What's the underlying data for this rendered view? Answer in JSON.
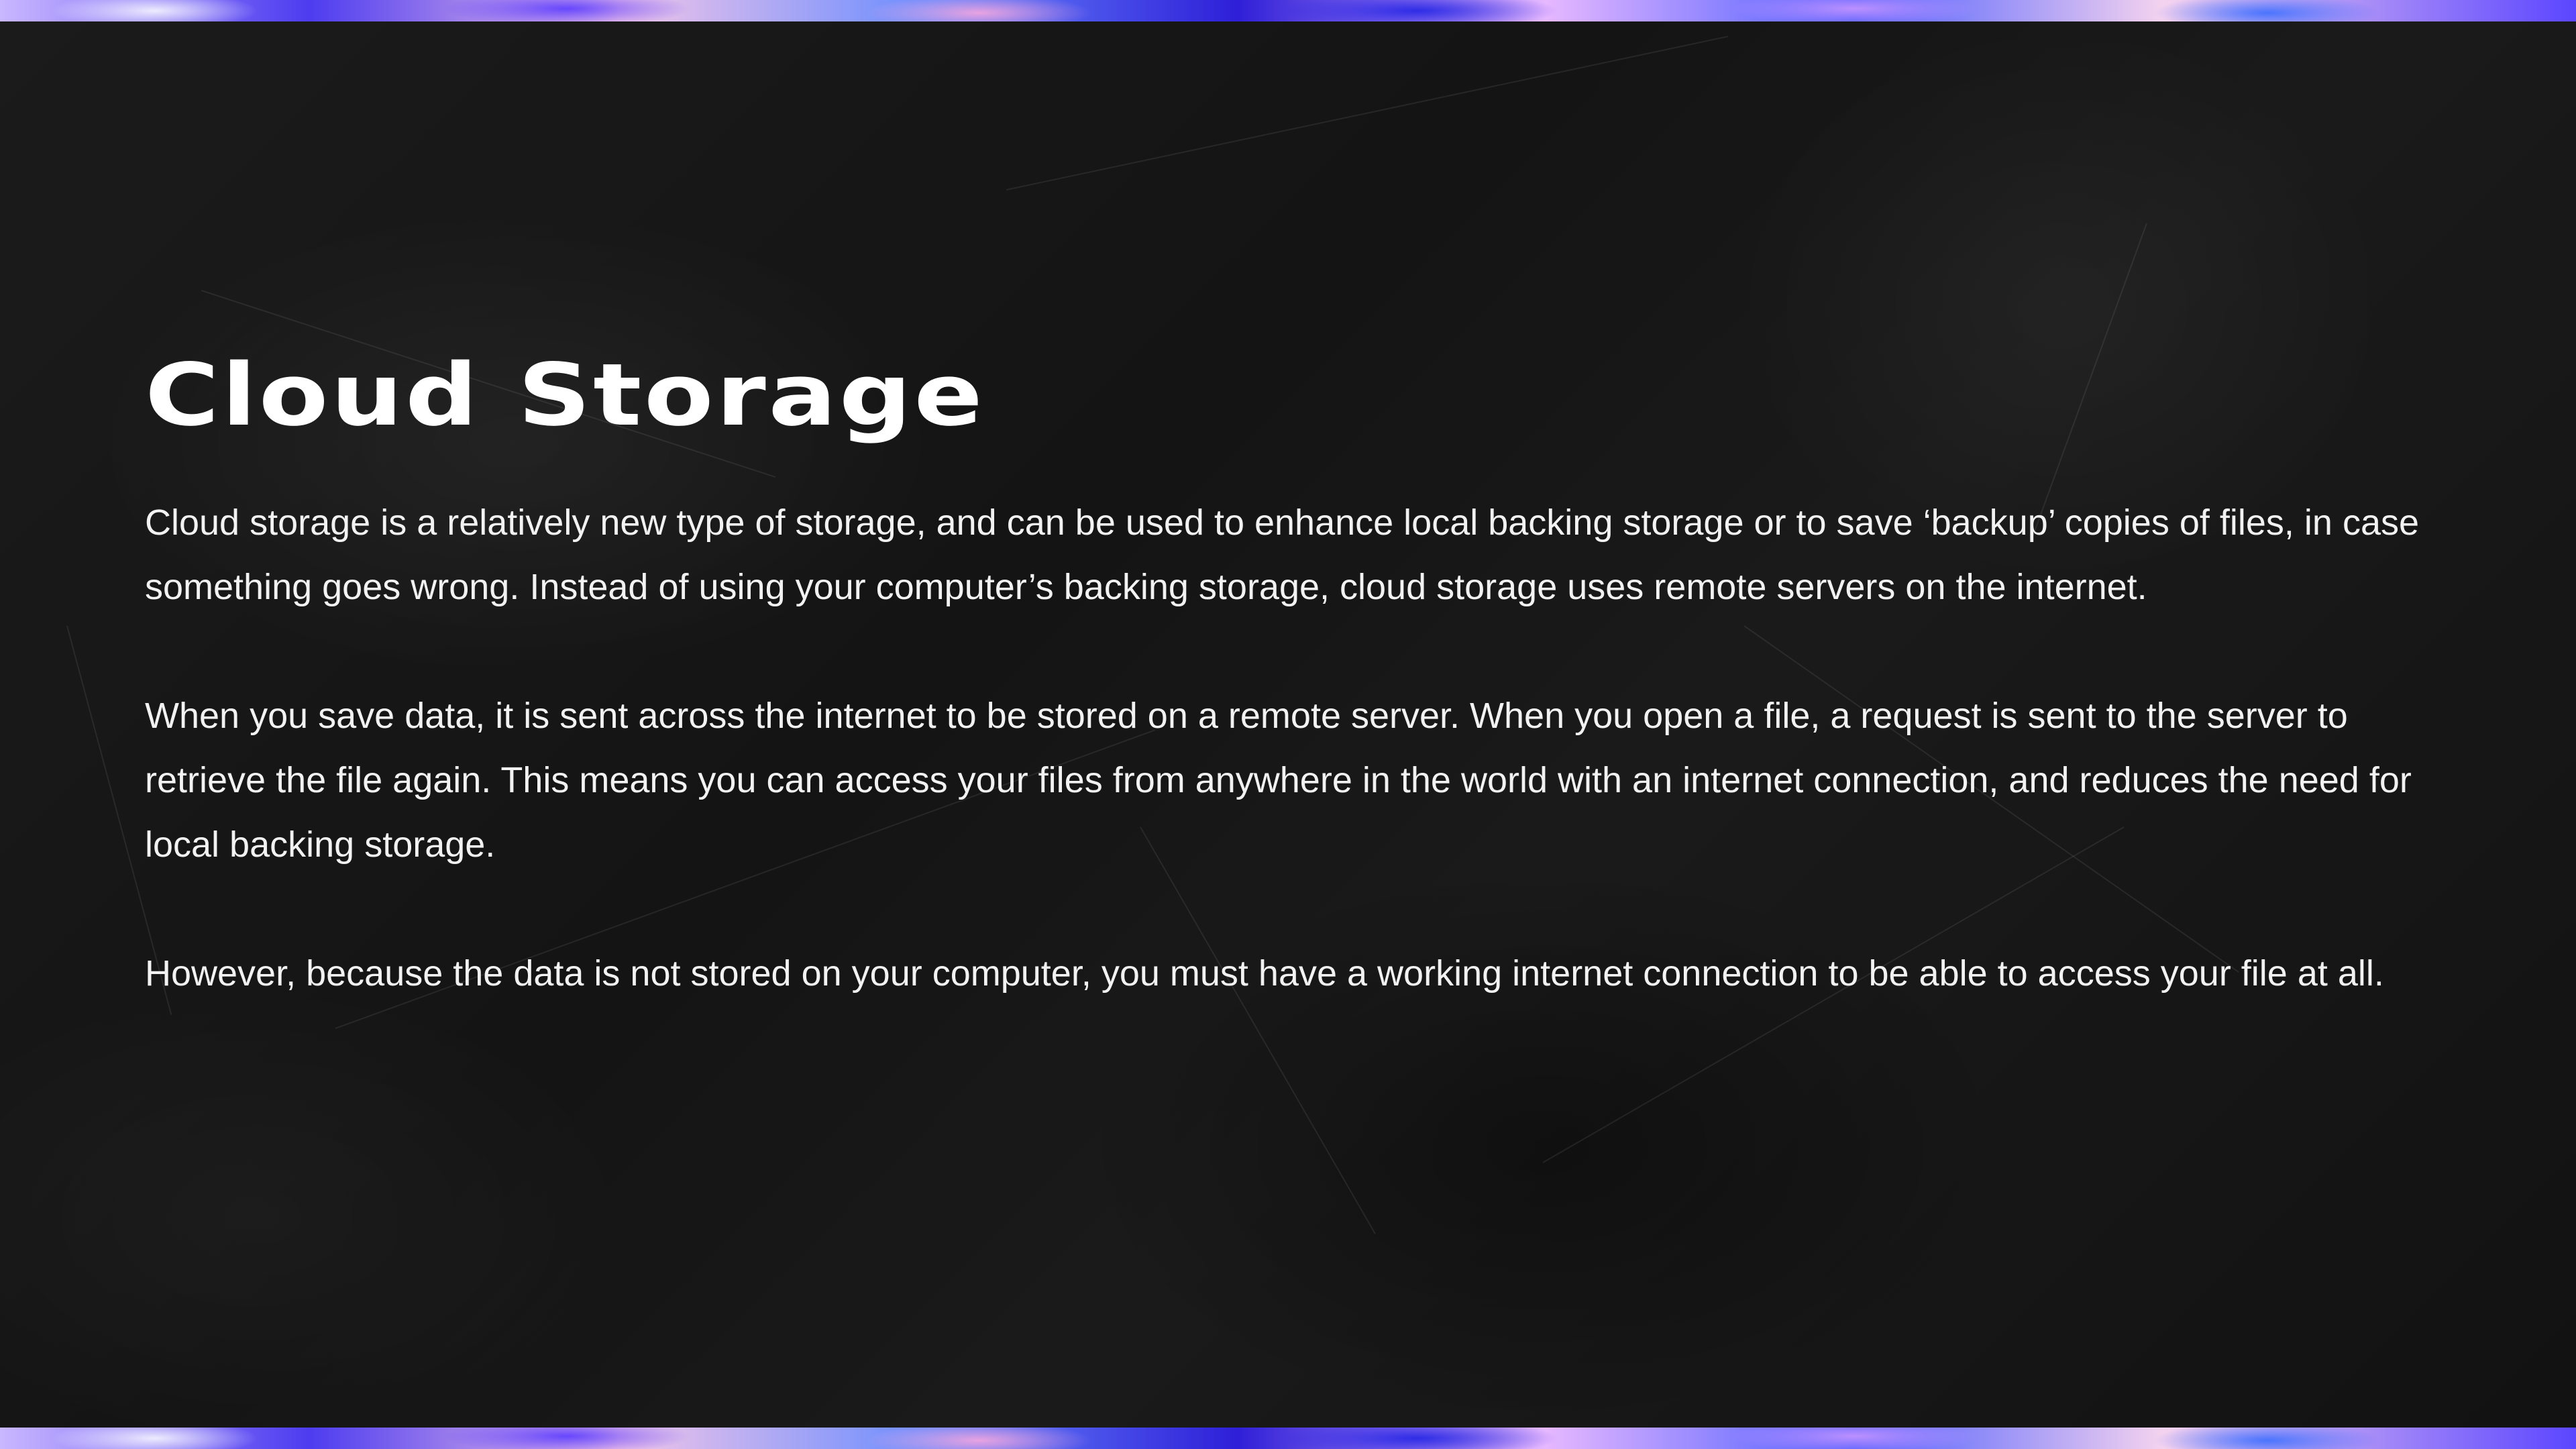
{
  "slide": {
    "title": "Cloud Storage",
    "paragraphs": [
      "Cloud storage is a relatively new type of storage, and can be used to enhance local backing storage or to save ‘backup’ copies of files, in case something goes wrong. Instead of using your computer’s backing storage, cloud storage uses remote servers on the internet.",
      "When you save data, it is sent across the internet to be stored on a remote server. When you open a file, a request is sent to the server to retrieve the file again. This means you can access your files from anywhere in the world with an internet connection, and reduces the need for local backing storage.",
      "However, because the data is not stored on your computer, you must have a working internet connection to be able to access your file at all."
    ]
  },
  "colors": {
    "background": "#121212",
    "text": "#ffffff",
    "border_accent": "#4d3cf0"
  }
}
